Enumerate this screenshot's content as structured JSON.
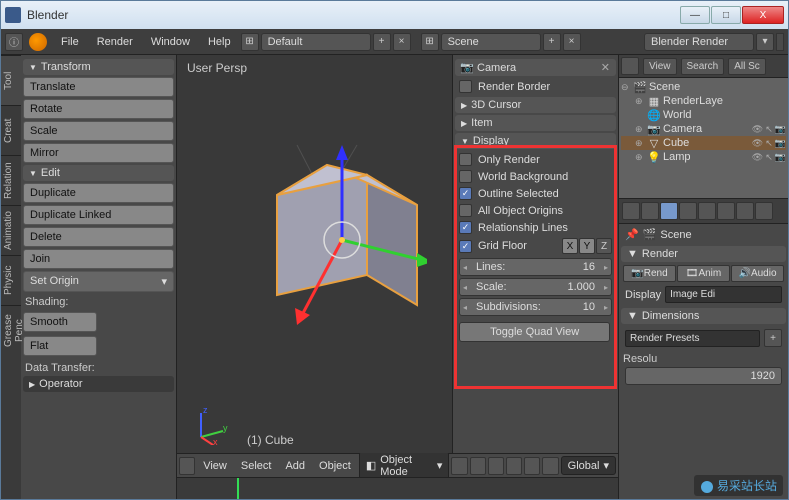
{
  "window": {
    "title": "Blender"
  },
  "win_buttons": {
    "min": "—",
    "max": "□",
    "close": "X"
  },
  "infobar": {
    "menus": [
      "File",
      "Render",
      "Window",
      "Help"
    ],
    "layout": "Default",
    "scene": "Scene",
    "engine": "Blender Render"
  },
  "toolshelf": {
    "tabs": [
      "Tool",
      "Creat",
      "Relation",
      "Animatio",
      "Physic",
      "Grease Penc"
    ],
    "transform": {
      "title": "Transform",
      "translate": "Translate",
      "rotate": "Rotate",
      "scale": "Scale",
      "mirror": "Mirror"
    },
    "edit": {
      "title": "Edit",
      "duplicate": "Duplicate",
      "duplicate_linked": "Duplicate Linked",
      "delete": "Delete",
      "join": "Join",
      "set_origin": "Set Origin"
    },
    "shading": {
      "title": "Shading:",
      "smooth": "Smooth",
      "flat": "Flat"
    },
    "data_transfer": "Data Transfer:",
    "operator": "Operator"
  },
  "viewport": {
    "persp": "User Persp",
    "object": "(1) Cube"
  },
  "npanel": {
    "camera": "Camera",
    "render_border": "Render Border",
    "cursor": "3D Cursor",
    "item": "Item",
    "display": {
      "title": "Display",
      "only_render": "Only Render",
      "world_bg": "World Background",
      "outline_sel": "Outline Selected",
      "all_origins": "All Object Origins",
      "rel_lines": "Relationship Lines",
      "grid_floor": "Grid Floor",
      "axes": [
        "X",
        "Y",
        "Z"
      ],
      "lines_label": "Lines:",
      "lines_value": "16",
      "scale_label": "Scale:",
      "scale_value": "1.000",
      "subdiv_label": "Subdivisions:",
      "subdiv_value": "10"
    },
    "toggle_quad": "Toggle Quad View"
  },
  "viewport_header": {
    "menus": [
      "View",
      "Select",
      "Add",
      "Object"
    ],
    "mode": "Object Mode",
    "orientation": "Global"
  },
  "outliner": {
    "view": "View",
    "search": "Search",
    "alls": "All Sc",
    "items": [
      {
        "name": "Scene",
        "depth": 0,
        "expand": "–"
      },
      {
        "name": "RenderLaye",
        "depth": 1,
        "expand": "+"
      },
      {
        "name": "World",
        "depth": 1,
        "expand": ""
      },
      {
        "name": "Camera",
        "depth": 1,
        "expand": "+"
      },
      {
        "name": "Cube",
        "depth": 1,
        "expand": "+",
        "selected": true
      },
      {
        "name": "Lamp",
        "depth": 1,
        "expand": "+"
      }
    ]
  },
  "properties": {
    "breadcrumb": "Scene",
    "render": "Render",
    "tabs": [
      "Rend",
      "Anim",
      "Audio"
    ],
    "display_label": "Display",
    "display_value": "Image Edi",
    "dimensions": "Dimensions",
    "presets": "Render Presets",
    "reso_label": "Resolu",
    "reso_value": "1920"
  },
  "watermark": "易采站长站",
  "chart_data": null
}
